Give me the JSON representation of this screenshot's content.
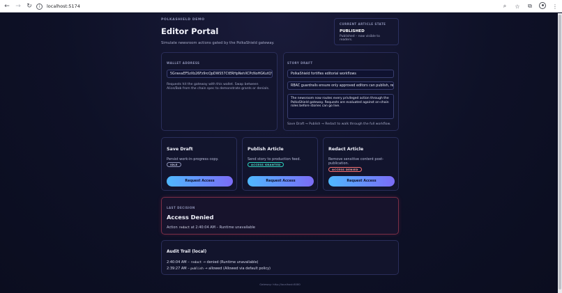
{
  "browser": {
    "url": "localhost:5174"
  },
  "header": {
    "eyebrow": "POLKASHIELD DEMO",
    "title": "Editor Portal",
    "subtitle": "Simulate newsroom actions gated by the PolkaShield gateway."
  },
  "article_state": {
    "label": "CURRENT ARTICLE STATE",
    "value": "PUBLISHED",
    "note": "Published – now visible to readers."
  },
  "wallet": {
    "label": "WALLET ADDRESS",
    "value": "5GrwvaEF5zXb26Fz9rcQpDWS57CtERHpNehXCPcNoHGKutQY",
    "help": "Requests hit the gateway with this wallet. Swap between Alice/Bob from the chain spec to demonstrate grants or denials."
  },
  "story": {
    "label": "STORY DRAFT",
    "title_value": "PolkaShield fortifies editorial workflows",
    "summary_value": "RBAC guardrails ensure only approved editors can publish, redact, or",
    "body_value": "The newsroom now routes every privileged action through the PolkaShield gateway. Requests are evaluated against on-chain roles before stories can go live.",
    "help": "Save Draft → Publish → Redact to walk through the full workflow."
  },
  "actions": [
    {
      "title": "Save Draft",
      "description": "Persist work-in-progress copy.",
      "badge": "IDLE",
      "button": "Request Access"
    },
    {
      "title": "Publish Article",
      "description": "Send story to production feed.",
      "badge": "ACCESS GRANTED",
      "button": "Request Access"
    },
    {
      "title": "Redact Article",
      "description": "Remove sensitive content post-publication.",
      "badge": "ACCESS DENIED",
      "button": "Request Access"
    }
  ],
  "decision": {
    "label": "LAST DECISION",
    "title": "Access Denied",
    "prefix": "Action",
    "action": "redact",
    "suffix": "at 2:40:04 AM – Runtime unavailable"
  },
  "audit": {
    "title": "Audit Trail (local)",
    "entries": [
      {
        "time": "2:40:04 AM –",
        "action": "redact",
        "result": "→ denied (Runtime unavailable)"
      },
      {
        "time": "2:39:27 AM –",
        "action": "publish",
        "result": "→ allowed (Allowed via default policy)"
      }
    ]
  },
  "footer": "Gateway: http://localhost:8080",
  "colors": {
    "accent_start": "#4fb8ff",
    "accent_end": "#7b6cf6",
    "granted": "#2dd4bf",
    "denied": "#f87171",
    "background": "#0d1024"
  }
}
